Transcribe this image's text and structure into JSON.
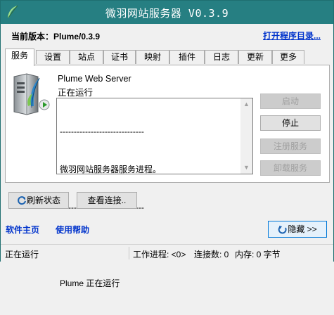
{
  "window": {
    "title": "微羽网站服务器 V0.3.9"
  },
  "header": {
    "version_label": "当前版本：Plume/0.3.9",
    "open_dir_link": "打开程序目录..."
  },
  "tabs": [
    {
      "label": "服务",
      "active": true
    },
    {
      "label": "设置"
    },
    {
      "label": "站点"
    },
    {
      "label": "证书"
    },
    {
      "label": "映射"
    },
    {
      "label": "插件"
    },
    {
      "label": "日志"
    },
    {
      "label": "更新"
    },
    {
      "label": "更多"
    }
  ],
  "service": {
    "name": "Plume Web Server",
    "status": "正在运行",
    "log_lines": [
      "------------------------------",
      "微羽网站服务器服务进程。",
      "------------------------------",
      "",
      "Plume 正在运行"
    ],
    "buttons": {
      "start": "启动",
      "stop": "停止",
      "register": "注册服务",
      "unregister": "卸载服务",
      "refresh": "刷新状态",
      "view_connections": "查看连接.."
    }
  },
  "footer_links": {
    "homepage": "软件主页",
    "help": "使用帮助"
  },
  "hide_button": "隐藏 >>",
  "statusbar": {
    "status": "正在运行",
    "workers": "工作进程: <0>",
    "connections": "连接数: 0",
    "memory": "内存: 0 字节"
  },
  "icons": {
    "app": "feather-icon",
    "server": "server-feather-icon",
    "refresh": "refresh-icon",
    "hide": "hide-arrow-icon"
  },
  "colors": {
    "titlebar": "#267f82",
    "link": "#0033cc",
    "accent_border": "#0078d7"
  }
}
